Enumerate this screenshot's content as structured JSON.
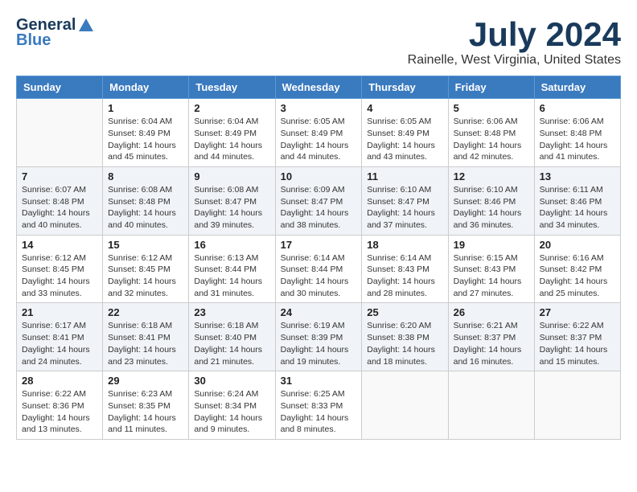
{
  "logo": {
    "general": "General",
    "blue": "Blue"
  },
  "title": "July 2024",
  "subtitle": "Rainelle, West Virginia, United States",
  "days_of_week": [
    "Sunday",
    "Monday",
    "Tuesday",
    "Wednesday",
    "Thursday",
    "Friday",
    "Saturday"
  ],
  "weeks": [
    [
      {
        "day": "",
        "sunrise": "",
        "sunset": "",
        "daylight": ""
      },
      {
        "day": "1",
        "sunrise": "Sunrise: 6:04 AM",
        "sunset": "Sunset: 8:49 PM",
        "daylight": "Daylight: 14 hours and 45 minutes."
      },
      {
        "day": "2",
        "sunrise": "Sunrise: 6:04 AM",
        "sunset": "Sunset: 8:49 PM",
        "daylight": "Daylight: 14 hours and 44 minutes."
      },
      {
        "day": "3",
        "sunrise": "Sunrise: 6:05 AM",
        "sunset": "Sunset: 8:49 PM",
        "daylight": "Daylight: 14 hours and 44 minutes."
      },
      {
        "day": "4",
        "sunrise": "Sunrise: 6:05 AM",
        "sunset": "Sunset: 8:49 PM",
        "daylight": "Daylight: 14 hours and 43 minutes."
      },
      {
        "day": "5",
        "sunrise": "Sunrise: 6:06 AM",
        "sunset": "Sunset: 8:48 PM",
        "daylight": "Daylight: 14 hours and 42 minutes."
      },
      {
        "day": "6",
        "sunrise": "Sunrise: 6:06 AM",
        "sunset": "Sunset: 8:48 PM",
        "daylight": "Daylight: 14 hours and 41 minutes."
      }
    ],
    [
      {
        "day": "7",
        "sunrise": "Sunrise: 6:07 AM",
        "sunset": "Sunset: 8:48 PM",
        "daylight": "Daylight: 14 hours and 40 minutes."
      },
      {
        "day": "8",
        "sunrise": "Sunrise: 6:08 AM",
        "sunset": "Sunset: 8:48 PM",
        "daylight": "Daylight: 14 hours and 40 minutes."
      },
      {
        "day": "9",
        "sunrise": "Sunrise: 6:08 AM",
        "sunset": "Sunset: 8:47 PM",
        "daylight": "Daylight: 14 hours and 39 minutes."
      },
      {
        "day": "10",
        "sunrise": "Sunrise: 6:09 AM",
        "sunset": "Sunset: 8:47 PM",
        "daylight": "Daylight: 14 hours and 38 minutes."
      },
      {
        "day": "11",
        "sunrise": "Sunrise: 6:10 AM",
        "sunset": "Sunset: 8:47 PM",
        "daylight": "Daylight: 14 hours and 37 minutes."
      },
      {
        "day": "12",
        "sunrise": "Sunrise: 6:10 AM",
        "sunset": "Sunset: 8:46 PM",
        "daylight": "Daylight: 14 hours and 36 minutes."
      },
      {
        "day": "13",
        "sunrise": "Sunrise: 6:11 AM",
        "sunset": "Sunset: 8:46 PM",
        "daylight": "Daylight: 14 hours and 34 minutes."
      }
    ],
    [
      {
        "day": "14",
        "sunrise": "Sunrise: 6:12 AM",
        "sunset": "Sunset: 8:45 PM",
        "daylight": "Daylight: 14 hours and 33 minutes."
      },
      {
        "day": "15",
        "sunrise": "Sunrise: 6:12 AM",
        "sunset": "Sunset: 8:45 PM",
        "daylight": "Daylight: 14 hours and 32 minutes."
      },
      {
        "day": "16",
        "sunrise": "Sunrise: 6:13 AM",
        "sunset": "Sunset: 8:44 PM",
        "daylight": "Daylight: 14 hours and 31 minutes."
      },
      {
        "day": "17",
        "sunrise": "Sunrise: 6:14 AM",
        "sunset": "Sunset: 8:44 PM",
        "daylight": "Daylight: 14 hours and 30 minutes."
      },
      {
        "day": "18",
        "sunrise": "Sunrise: 6:14 AM",
        "sunset": "Sunset: 8:43 PM",
        "daylight": "Daylight: 14 hours and 28 minutes."
      },
      {
        "day": "19",
        "sunrise": "Sunrise: 6:15 AM",
        "sunset": "Sunset: 8:43 PM",
        "daylight": "Daylight: 14 hours and 27 minutes."
      },
      {
        "day": "20",
        "sunrise": "Sunrise: 6:16 AM",
        "sunset": "Sunset: 8:42 PM",
        "daylight": "Daylight: 14 hours and 25 minutes."
      }
    ],
    [
      {
        "day": "21",
        "sunrise": "Sunrise: 6:17 AM",
        "sunset": "Sunset: 8:41 PM",
        "daylight": "Daylight: 14 hours and 24 minutes."
      },
      {
        "day": "22",
        "sunrise": "Sunrise: 6:18 AM",
        "sunset": "Sunset: 8:41 PM",
        "daylight": "Daylight: 14 hours and 23 minutes."
      },
      {
        "day": "23",
        "sunrise": "Sunrise: 6:18 AM",
        "sunset": "Sunset: 8:40 PM",
        "daylight": "Daylight: 14 hours and 21 minutes."
      },
      {
        "day": "24",
        "sunrise": "Sunrise: 6:19 AM",
        "sunset": "Sunset: 8:39 PM",
        "daylight": "Daylight: 14 hours and 19 minutes."
      },
      {
        "day": "25",
        "sunrise": "Sunrise: 6:20 AM",
        "sunset": "Sunset: 8:38 PM",
        "daylight": "Daylight: 14 hours and 18 minutes."
      },
      {
        "day": "26",
        "sunrise": "Sunrise: 6:21 AM",
        "sunset": "Sunset: 8:37 PM",
        "daylight": "Daylight: 14 hours and 16 minutes."
      },
      {
        "day": "27",
        "sunrise": "Sunrise: 6:22 AM",
        "sunset": "Sunset: 8:37 PM",
        "daylight": "Daylight: 14 hours and 15 minutes."
      }
    ],
    [
      {
        "day": "28",
        "sunrise": "Sunrise: 6:22 AM",
        "sunset": "Sunset: 8:36 PM",
        "daylight": "Daylight: 14 hours and 13 minutes."
      },
      {
        "day": "29",
        "sunrise": "Sunrise: 6:23 AM",
        "sunset": "Sunset: 8:35 PM",
        "daylight": "Daylight: 14 hours and 11 minutes."
      },
      {
        "day": "30",
        "sunrise": "Sunrise: 6:24 AM",
        "sunset": "Sunset: 8:34 PM",
        "daylight": "Daylight: 14 hours and 9 minutes."
      },
      {
        "day": "31",
        "sunrise": "Sunrise: 6:25 AM",
        "sunset": "Sunset: 8:33 PM",
        "daylight": "Daylight: 14 hours and 8 minutes."
      },
      {
        "day": "",
        "sunrise": "",
        "sunset": "",
        "daylight": ""
      },
      {
        "day": "",
        "sunrise": "",
        "sunset": "",
        "daylight": ""
      },
      {
        "day": "",
        "sunrise": "",
        "sunset": "",
        "daylight": ""
      }
    ]
  ]
}
